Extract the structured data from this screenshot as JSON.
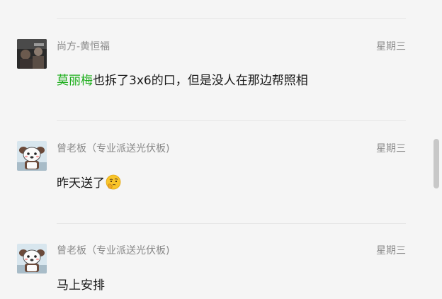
{
  "messages": [
    {
      "sender": "尚方-黄恒福",
      "time": "星期三",
      "mention": "莫丽梅",
      "text": "也拆了3x6的口，但是没人在那边帮照相",
      "avatar_icon": "photo-avatar"
    },
    {
      "sender": "曾老板（专业派送光伏板)",
      "time": "星期三",
      "text": "昨天送了",
      "emoji_icon": "thinking-face-icon",
      "avatar_icon": "cartoon-dog-avatar"
    },
    {
      "sender": "曾老板（专业派送光伏板)",
      "time": "星期三",
      "text": "马上安排",
      "avatar_icon": "cartoon-dog-avatar"
    }
  ],
  "colors": {
    "background": "#f5f5f5",
    "mention": "#1aad19",
    "meta_text": "#8a8a8a",
    "body_text": "#1a1a1a"
  }
}
